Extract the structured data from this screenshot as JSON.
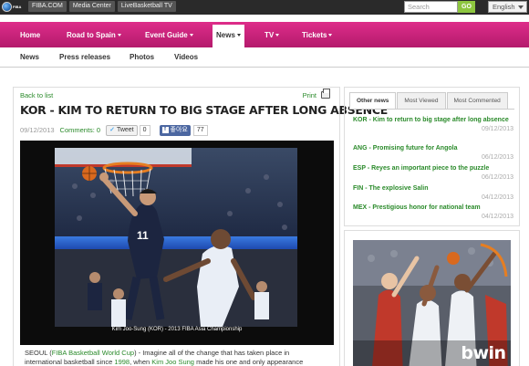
{
  "topbar": {
    "logo_text": "FIBA",
    "links": [
      "FIBA.COM",
      "Media Center",
      "LiveBasketball TV"
    ],
    "search_placeholder": "Search",
    "go_label": "GO",
    "language": "English"
  },
  "mainnav": {
    "items": [
      {
        "label": "Home",
        "dropdown": false
      },
      {
        "label": "Road to Spain",
        "dropdown": true
      },
      {
        "label": "Event Guide",
        "dropdown": true
      },
      {
        "label": "News",
        "dropdown": true,
        "active": true
      },
      {
        "label": "TV",
        "dropdown": true
      },
      {
        "label": "Tickets",
        "dropdown": true
      }
    ]
  },
  "subnav": {
    "items": [
      "News",
      "Press releases",
      "Photos",
      "Videos"
    ]
  },
  "article": {
    "back_label": "Back to list",
    "print_label": "Print",
    "title": "KOR - KIM TO RETURN TO BIG STAGE AFTER LONG ABSENCE",
    "date": "09/12/2013",
    "comments_label": "Comments:",
    "comments_count": "0",
    "tweet_label": "Tweet",
    "tweet_count": "0",
    "fb_label": "좋아요",
    "fb_count": "77",
    "photo_caption": "Kim Joo-Sung (KOR) - 2013 FIBA Asia Championship",
    "body_p1_a": "SEOUL (",
    "body_p1_link": "FIBA Basketball World Cup",
    "body_p1_b": ") - Imagine all of the change that has taken place in",
    "body_p2_a": "international basketball since ",
    "body_p2_link1": "1998",
    "body_p2_b": ", when ",
    "body_p2_link2": "Kim Joo Sung",
    "body_p2_c": " made his one and only appearance"
  },
  "sidebar": {
    "tabs": [
      "Other news",
      "Most Viewed",
      "Most Commented"
    ],
    "news": [
      {
        "title": "KOR - Kim to return to big stage after long absence",
        "date": "09/12/2013"
      },
      {
        "title": "ANG - Promising future for Angola",
        "date": "06/12/2013"
      },
      {
        "title": "ESP - Reyes an important piece to the puzzle",
        "date": "06/12/2013"
      },
      {
        "title": "FIN - The explosive Salin",
        "date": "04/12/2013"
      },
      {
        "title": "MEX - Prestigious honor for national team",
        "date": "04/12/2013"
      }
    ]
  },
  "ad": {
    "brand": "bwin"
  },
  "colors": {
    "nav_pink": "#c8207a",
    "link_green": "#2a8a2a",
    "go_green": "#8dc63f"
  }
}
